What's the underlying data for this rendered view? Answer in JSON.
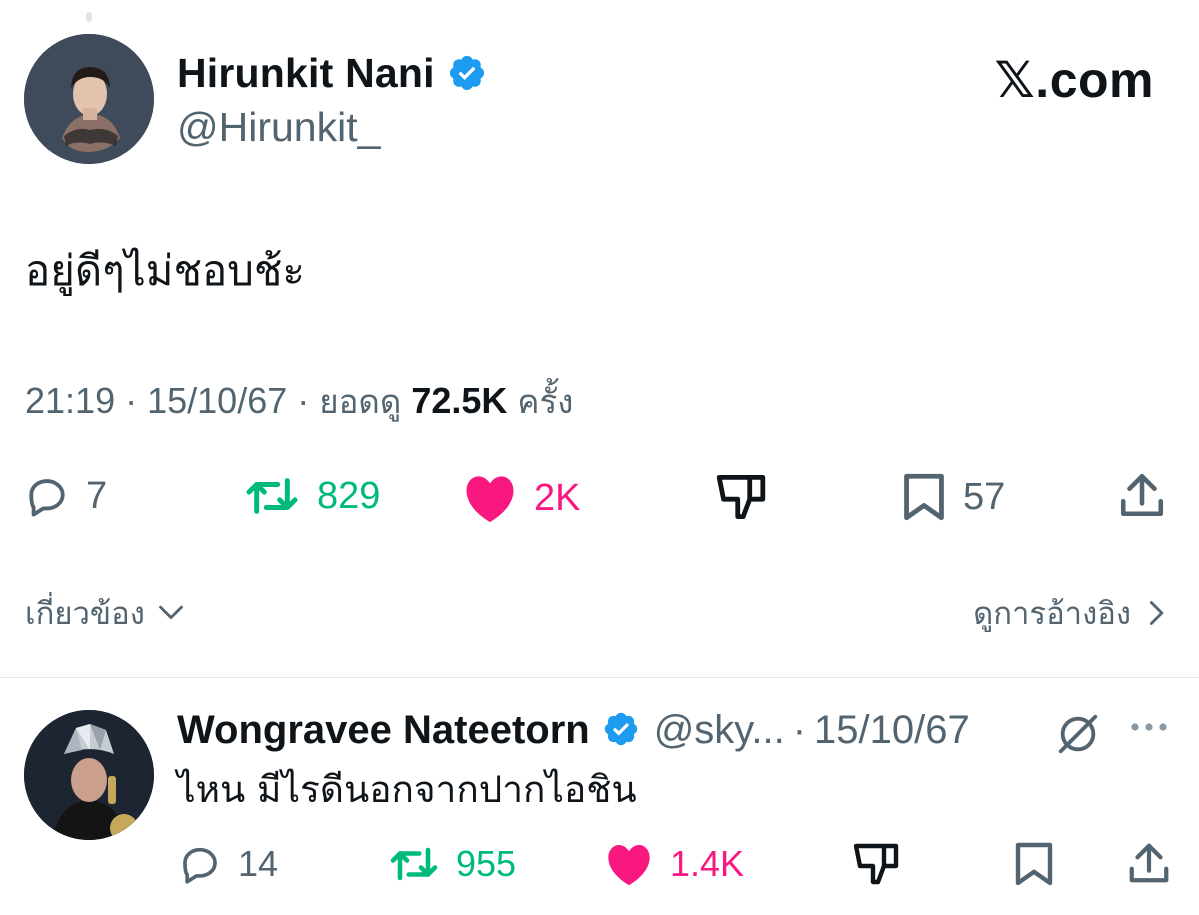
{
  "watermark": "𝕏.com",
  "tweet": {
    "author_name": "Hirunkit Nani",
    "author_handle": "@Hirunkit_",
    "text": "อยู่ดีๆไม่ชอบช้ะ",
    "time": "21:19",
    "date": "15/10/67",
    "views_label": "ยอดดู",
    "views_count": "72.5K",
    "views_suffix": "ครั้ง",
    "stats": {
      "replies": "7",
      "reposts": "829",
      "likes": "2K",
      "bookmarks": "57"
    },
    "related_label": "เกี่ยวข้อง",
    "quotes_label": "ดูการอ้างอิง"
  },
  "reply": {
    "author_name": "Wongravee Nateetorn",
    "author_handle": "@sky...",
    "date": "15/10/67",
    "text": "ไหน มีไรดีนอกจากปากไอชิน",
    "stats": {
      "replies": "14",
      "reposts": "955",
      "likes": "1.4K"
    }
  },
  "colors": {
    "text": "#0f1419",
    "secondary": "#536471",
    "verified": "#1d9bf0",
    "repost": "#00ba7c",
    "like": "#f91880"
  },
  "icons": [
    "reply-icon",
    "repost-icon",
    "like-icon",
    "dislike-icon",
    "bookmark-icon",
    "share-icon",
    "verified-icon",
    "grok-icon",
    "more-icon",
    "chevron-down-icon",
    "chevron-right-icon"
  ]
}
